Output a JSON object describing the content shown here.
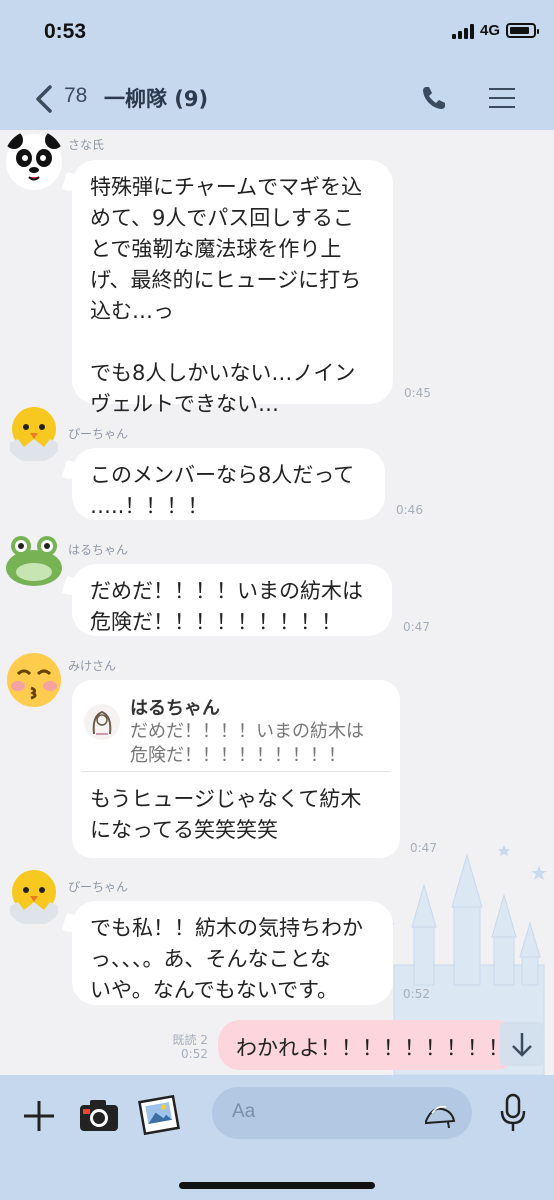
{
  "status_bar": {
    "time": "0:53",
    "network": "4G"
  },
  "header": {
    "back_count": "78",
    "title": "一柳隊 (9)"
  },
  "messages": [
    {
      "sender": "さな氏",
      "text": "特殊弾にチャームでマギを込\nめて、9人でパス回しするこ\nとで強靭な魔法球を作り上\nげ、最終的にヒュージに打ち\n込む…っ\n\nでも8人しかいない…ノイン\nヴェルトできない…",
      "time": "0:45",
      "avatar": "panda-avatar"
    },
    {
      "sender": "ぴーちゃん",
      "text": "このメンバーなら8人だって\n…..！！！！",
      "time": "0:46",
      "avatar": "chick-avatar"
    },
    {
      "sender": "はるちゃん",
      "text": "だめだ！！！！いまの紡木は\n危険だ！！！！！！！！！",
      "time": "0:47",
      "avatar": "frog-avatar"
    },
    {
      "sender": "みけさん",
      "reply_to_name": "はるちゃん",
      "reply_to_text": "だめだ！！！！いまの紡木は\n危険だ！！！！！！！！！",
      "text": "もうヒュージじゃなくて紡木\nになってる笑笑笑笑",
      "time": "0:47",
      "avatar": "kiss-face-avatar"
    },
    {
      "sender": "ぴーちゃん",
      "text": "でも私！！紡木の気持ちわか\nっ、、、。あ、そんなことな\nいや。なんでもないです。",
      "time": "0:52",
      "avatar": "chick-avatar"
    }
  ],
  "my_message": {
    "read_label": "既読 2",
    "time": "0:52",
    "text": "わかれよ！！！！！！！！！"
  },
  "input": {
    "placeholder": "Aa"
  },
  "colors": {
    "bar_blue": "#c5d8ee",
    "chat_bg": "#f1f1f4",
    "my_bubble": "#fcd5dd"
  }
}
